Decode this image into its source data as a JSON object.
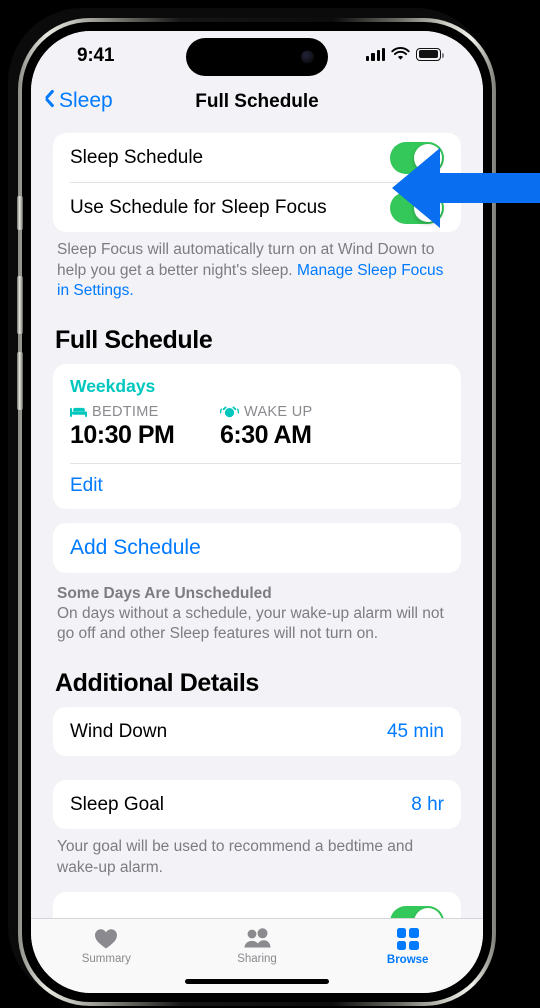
{
  "status_bar": {
    "time": "9:41",
    "cellular_icon": "cellular-bars-icon",
    "wifi_icon": "wifi-icon",
    "battery_icon": "battery-icon"
  },
  "nav": {
    "back_label": "Sleep",
    "back_icon": "chevron-left-icon",
    "title": "Full Schedule"
  },
  "settings_group": {
    "rows": [
      {
        "label": "Sleep Schedule",
        "toggle_on": true
      },
      {
        "label": "Use Schedule for Sleep Focus",
        "toggle_on": true
      }
    ],
    "footnote_text": "Sleep Focus will automatically turn on at Wind Down to help you get a better night's sleep. ",
    "footnote_link": "Manage Sleep Focus in Settings."
  },
  "full_schedule": {
    "section_title": "Full Schedule",
    "days": "Weekdays",
    "bedtime_icon": "bed-icon",
    "bedtime_label": "BEDTIME",
    "bedtime_value": "10:30 PM",
    "wakeup_icon": "alarm-clock-icon",
    "wakeup_label": "WAKE UP",
    "wakeup_value": "6:30 AM",
    "edit_label": "Edit",
    "add_schedule_label": "Add Schedule",
    "note_title": "Some Days Are Unscheduled",
    "note_body": "On days without a schedule, your wake-up alarm will not go off and other Sleep features will not turn on."
  },
  "additional_details": {
    "section_title": "Additional Details",
    "wind_down": {
      "label": "Wind Down",
      "value": "45 min"
    },
    "sleep_goal": {
      "label": "Sleep Goal",
      "value": "8 hr"
    },
    "sleep_goal_footnote": "Your goal will be used to recommend a bedtime and wake-up alarm."
  },
  "tab_bar": {
    "tabs": [
      {
        "label": "Summary",
        "icon": "heart-icon",
        "active": false
      },
      {
        "label": "Sharing",
        "icon": "people-icon",
        "active": false
      },
      {
        "label": "Browse",
        "icon": "grid-icon",
        "active": true
      }
    ]
  },
  "annotation": {
    "arrow_icon": "left-pointing-arrow-callout",
    "arrow_color": "#0a6ef0",
    "points_at": "Sleep Schedule toggle"
  },
  "colors": {
    "accent_blue": "#007aff",
    "toggle_green": "#34c759",
    "teal": "#00c7be",
    "background": "#f2f2f7"
  }
}
